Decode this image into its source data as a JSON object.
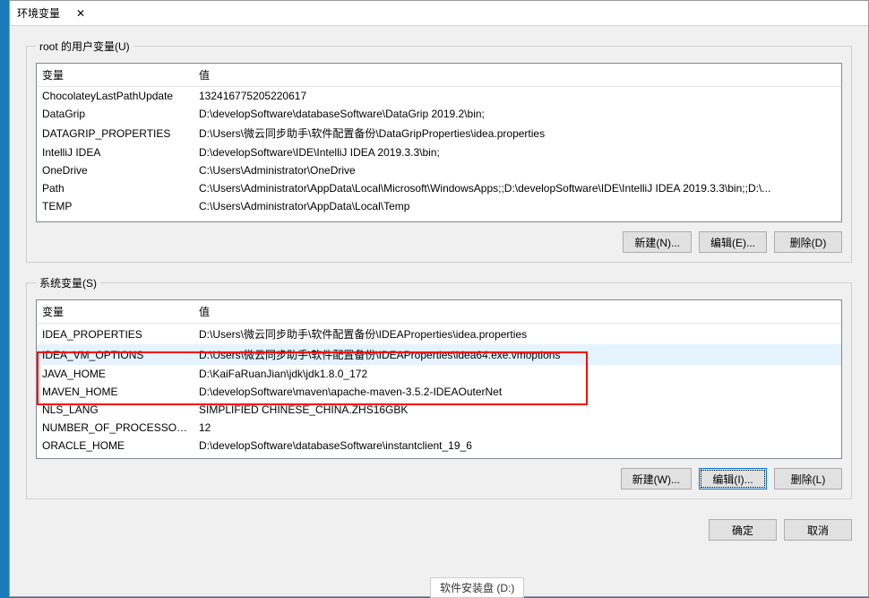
{
  "window": {
    "title": "环境变量",
    "close": "✕"
  },
  "user_vars": {
    "legend": "root 的用户变量(U)",
    "col_var": "变量",
    "col_val": "值",
    "rows": [
      {
        "name": "ChocolateyLastPathUpdate",
        "value": "132416775205220617"
      },
      {
        "name": "DataGrip",
        "value": "D:\\developSoftware\\databaseSoftware\\DataGrip 2019.2\\bin;"
      },
      {
        "name": "DATAGRIP_PROPERTIES",
        "value": "D:\\Users\\微云同步助手\\软件配置备份\\DataGripProperties\\idea.properties"
      },
      {
        "name": "IntelliJ IDEA",
        "value": "D:\\developSoftware\\IDE\\IntelliJ IDEA 2019.3.3\\bin;"
      },
      {
        "name": "OneDrive",
        "value": "C:\\Users\\Administrator\\OneDrive"
      },
      {
        "name": "Path",
        "value": "C:\\Users\\Administrator\\AppData\\Local\\Microsoft\\WindowsApps;;D:\\developSoftware\\IDE\\IntelliJ IDEA 2019.3.3\\bin;;D:\\..."
      },
      {
        "name": "TEMP",
        "value": "C:\\Users\\Administrator\\AppData\\Local\\Temp"
      }
    ],
    "btn_new": "新建(N)...",
    "btn_edit": "编辑(E)...",
    "btn_delete": "删除(D)"
  },
  "system_vars": {
    "legend": "系统变量(S)",
    "col_var": "变量",
    "col_val": "值",
    "rows": [
      {
        "name": "IDEA_PROPERTIES",
        "value": "D:\\Users\\微云同步助手\\软件配置备份\\IDEAProperties\\idea.properties"
      },
      {
        "name": "IDEA_VM_OPTIONS",
        "value": "D:\\Users\\微云同步助手\\软件配置备份\\IDEAProperties\\idea64.exe.vmoptions"
      },
      {
        "name": "JAVA_HOME",
        "value": "D:\\KaiFaRuanJian\\jdk\\jdk1.8.0_172"
      },
      {
        "name": "MAVEN_HOME",
        "value": "D:\\developSoftware\\maven\\apache-maven-3.5.2-IDEAOuterNet"
      },
      {
        "name": "NLS_LANG",
        "value": "SIMPLIFIED CHINESE_CHINA.ZHS16GBK"
      },
      {
        "name": "NUMBER_OF_PROCESSORS",
        "value": "12"
      },
      {
        "name": "ORACLE_HOME",
        "value": "D:\\developSoftware\\databaseSoftware\\instantclient_19_6"
      }
    ],
    "btn_new": "新建(W)...",
    "btn_edit": "编辑(I)...",
    "btn_delete": "删除(L)"
  },
  "dialog": {
    "ok": "确定",
    "cancel": "取消"
  },
  "bottom_hint": "软件安装盘 (D:)"
}
